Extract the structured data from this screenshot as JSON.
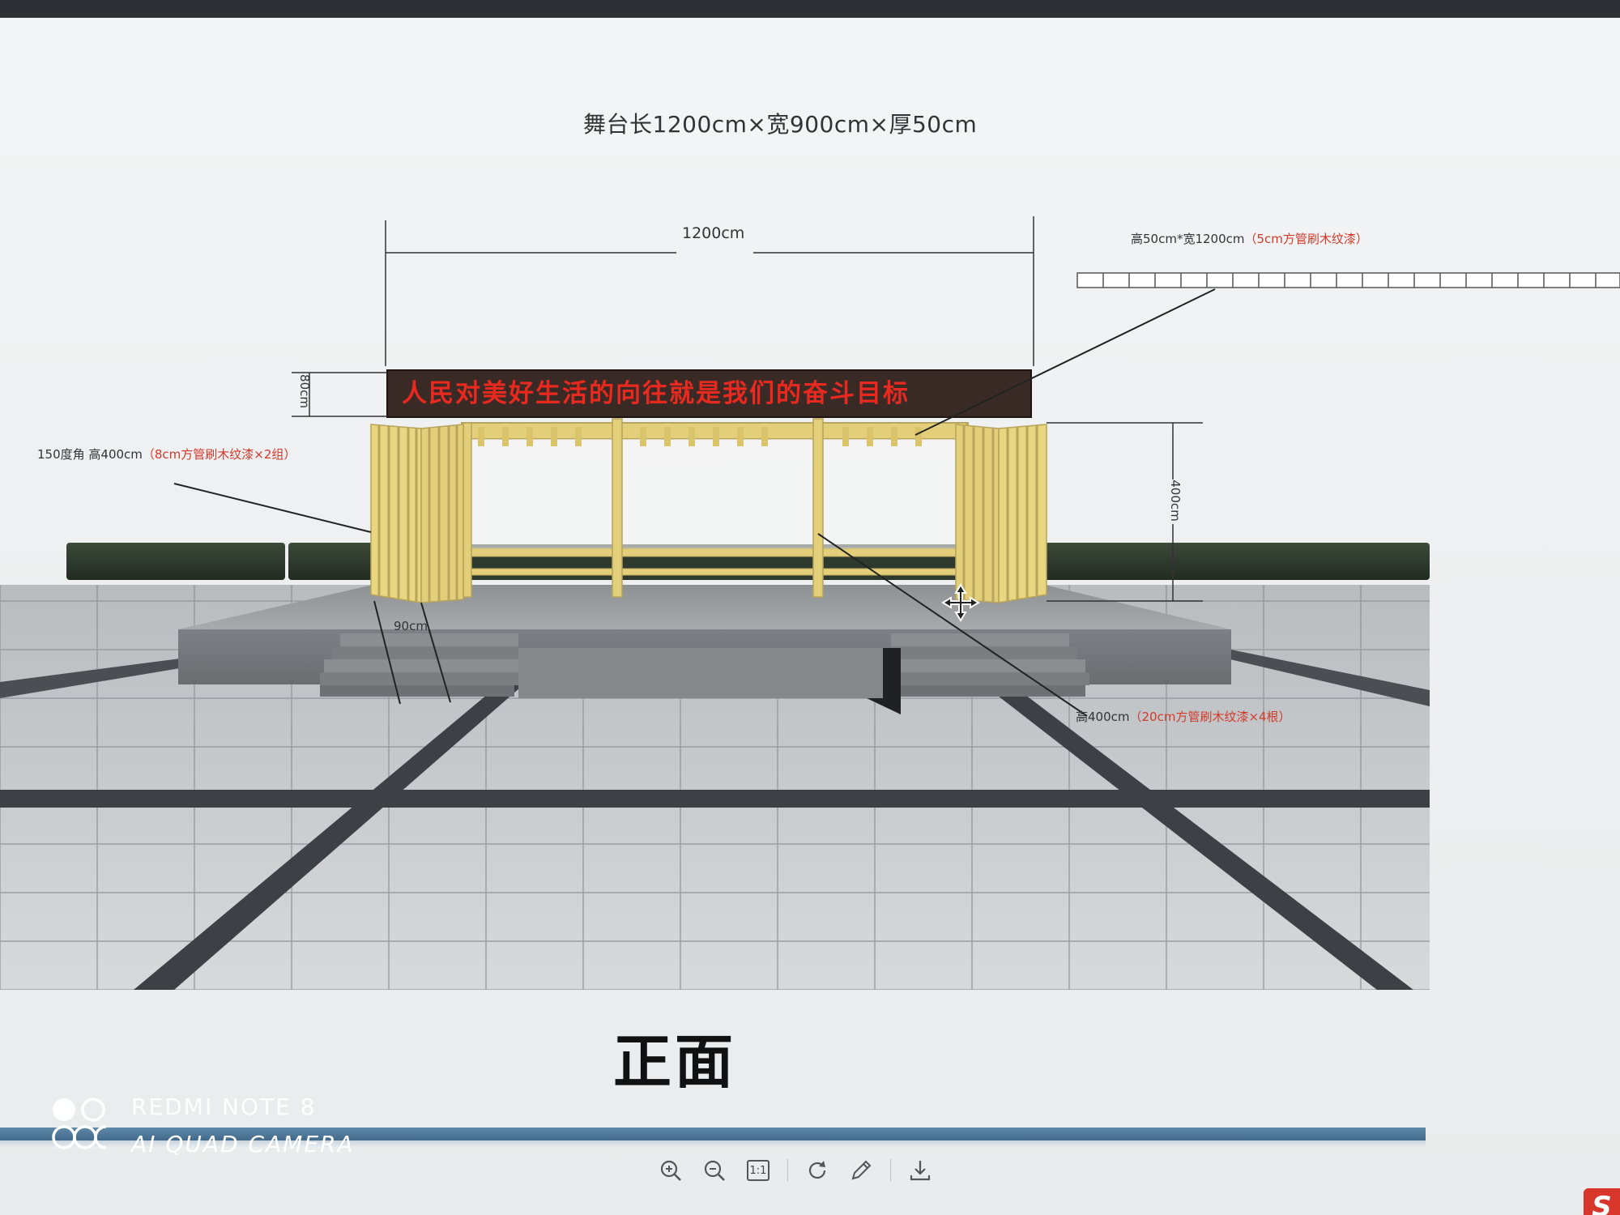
{
  "viewer": {
    "stage_dimensions": "舞台长1200cm×宽900cm×厚50cm",
    "width_dim": "1200cm",
    "banner_height_dim": "80cm",
    "pillar_height_dim": "400cm",
    "step_dim": "90cm",
    "banner_text": "人民对美好生活的向往就是我们的奋斗目标",
    "callout_beam": {
      "text": "高50cm*宽1200cm",
      "note": "（5cm方管刷木纹漆）"
    },
    "callout_side": {
      "text": "150度角  高400cm",
      "note": "（8cm方管刷木纹漆×2组）"
    },
    "callout_post": {
      "text": "高400cm",
      "note": "（20cm方管刷木纹漆×4根）"
    },
    "view_label": "正面"
  },
  "toolbar": {
    "zoom_in": "zoom-in-icon",
    "zoom_out": "zoom-out-icon",
    "actual_size": "1:1",
    "rotate": "rotate-icon",
    "edit": "pencil-icon",
    "download": "download-icon"
  },
  "watermark": {
    "line1": "REDMI NOTE 8",
    "line2": "AI QUAD CAMERA"
  },
  "colors": {
    "banner_bg": "#3a2a26",
    "banner_text": "#e8291f",
    "frame": "#e3cf7a",
    "callout_red": "#d23a2a",
    "progress_bar": "#4d7596"
  }
}
